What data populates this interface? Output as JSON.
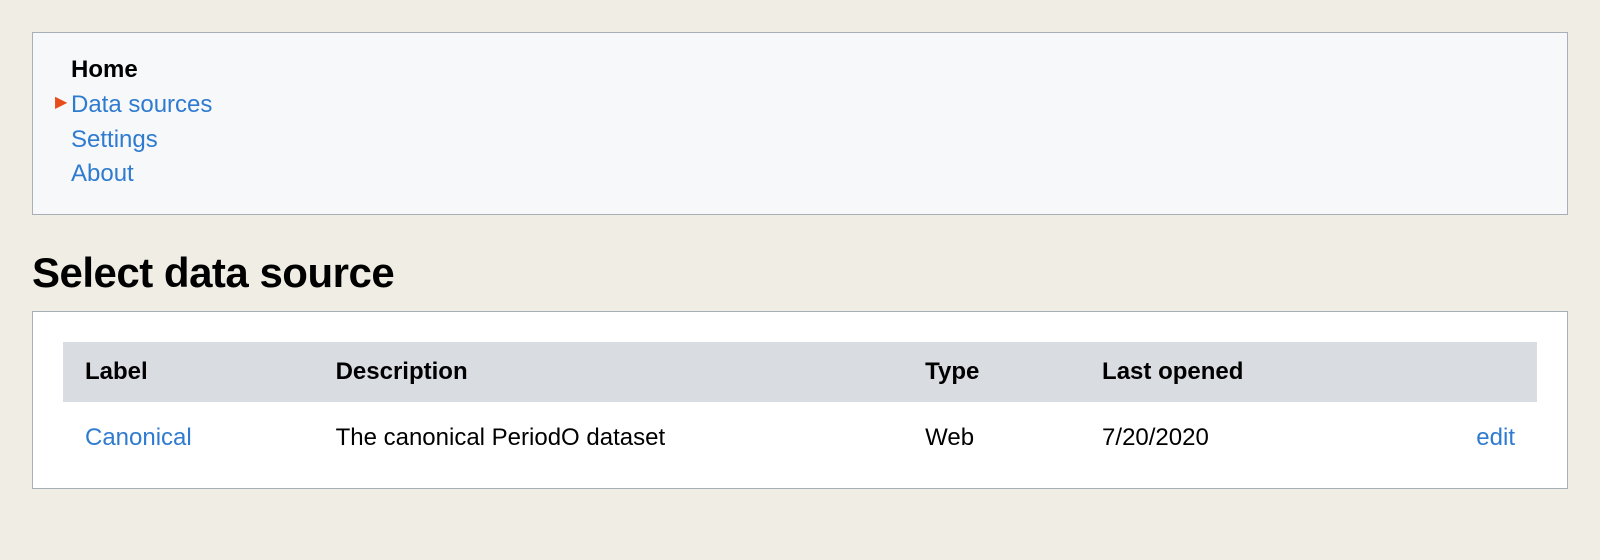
{
  "nav": {
    "items": [
      {
        "label": "Home",
        "current": true,
        "active": false
      },
      {
        "label": "Data sources",
        "current": false,
        "active": true
      },
      {
        "label": "Settings",
        "current": false,
        "active": false
      },
      {
        "label": "About",
        "current": false,
        "active": false
      }
    ]
  },
  "page": {
    "title": "Select data source"
  },
  "table": {
    "headers": {
      "label": "Label",
      "description": "Description",
      "type": "Type",
      "last_opened": "Last opened",
      "action": ""
    },
    "rows": [
      {
        "label": "Canonical",
        "description": "The canonical PeriodO dataset",
        "type": "Web",
        "last_opened": "7/20/2020",
        "action": "edit"
      }
    ]
  }
}
